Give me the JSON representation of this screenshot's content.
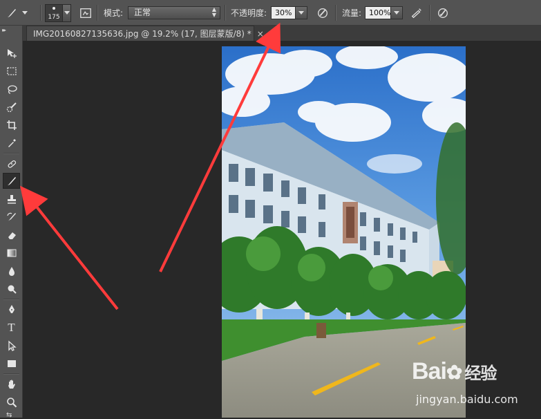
{
  "options_bar": {
    "brush_size": "175",
    "mode_label": "模式:",
    "mode_value": "正常",
    "opacity_label": "不透明度:",
    "opacity_value": "30%",
    "flow_label": "流量:",
    "flow_value": "100%"
  },
  "document_tab": {
    "title": "IMG20160827135636.jpg @ 19.2% (17, 图层蒙版/8) *",
    "close_glyph": "×"
  },
  "tools": [
    {
      "name": "move-icon"
    },
    {
      "name": "marquee-icon"
    },
    {
      "name": "lasso-icon"
    },
    {
      "name": "quick-select-icon"
    },
    {
      "name": "crop-icon"
    },
    {
      "name": "eyedropper-icon"
    },
    {
      "name": "healing-brush-icon"
    },
    {
      "name": "brush-icon",
      "active": true
    },
    {
      "name": "clone-stamp-icon"
    },
    {
      "name": "history-brush-icon"
    },
    {
      "name": "eraser-icon"
    },
    {
      "name": "gradient-icon"
    },
    {
      "name": "blur-icon"
    },
    {
      "name": "dodge-icon"
    },
    {
      "name": "pen-icon"
    },
    {
      "name": "type-icon",
      "glyph": "T"
    },
    {
      "name": "path-select-icon"
    },
    {
      "name": "rectangle-icon"
    },
    {
      "name": "hand-icon"
    },
    {
      "name": "zoom-icon"
    }
  ],
  "watermark": {
    "brand": "Bai",
    "brand_suffix": "经验",
    "url": "jingyan.baidu.com"
  },
  "colors": {
    "panel": "#535353",
    "canvas_bg": "#282828",
    "annotation_arrow": "#ff3b3b"
  }
}
